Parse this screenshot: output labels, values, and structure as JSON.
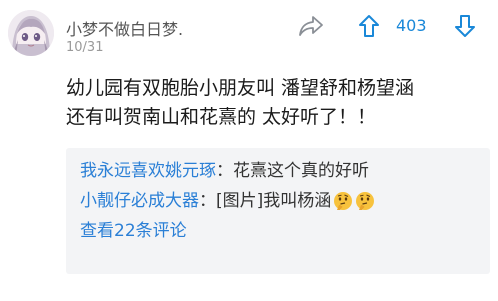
{
  "post": {
    "username": "小梦不做白日梦.",
    "date": "10/31",
    "vote_count": "403",
    "body_lines": [
      "幼儿园有双胞胎小朋友叫 潘望舒和杨望涵",
      "还有叫贺南山和花熹的 太好听了！！"
    ]
  },
  "icons": {
    "avatar": "anime-girl-avatar",
    "share": "share-arrow-icon",
    "upvote": "up-arrow-icon",
    "downvote": "down-arrow-icon",
    "thinking": "thinking-face-emoji"
  },
  "colors": {
    "accent": "#1a88d8",
    "reply_name": "#2a7fd6",
    "reply_bg": "#f3f4f6"
  },
  "replies": [
    {
      "name": "我永远喜欢姚元琢",
      "sep": "：",
      "text": "花熹这个真的好听"
    },
    {
      "name": "小靓仔必成大器",
      "sep": "：",
      "text": "[图片]我叫杨涵"
    }
  ],
  "view_more": "查看22条评论"
}
